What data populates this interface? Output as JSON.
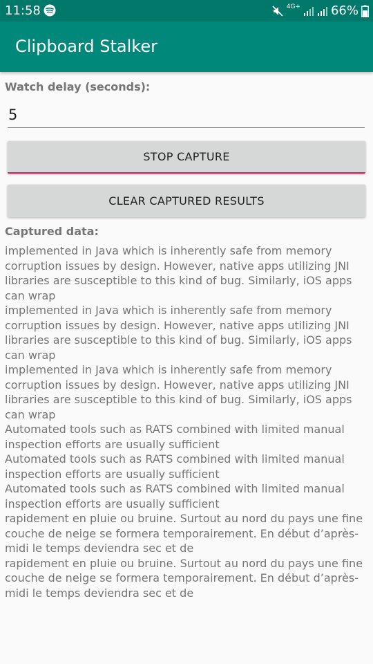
{
  "status_bar": {
    "time": "11:58",
    "network_label": "4G+",
    "battery": "66%"
  },
  "app": {
    "title": "Clipboard Stalker",
    "accent_color": "#00897b",
    "status_color": "#00796b"
  },
  "form": {
    "delay_label": "Watch delay (seconds):",
    "delay_value": "5",
    "stop_button": "STOP CAPTURE",
    "clear_button": "CLEAR CAPTURED RESULTS",
    "captured_label": "Captured data:"
  },
  "captured_text": "implemented in Java which is inherently safe from memory corruption issues by design. However, native apps utilizing JNI libraries are susceptible to this kind of bug. Similarly, iOS apps can wrap\nimplemented in Java which is inherently safe from memory corruption issues by design. However, native apps utilizing JNI libraries are susceptible to this kind of bug. Similarly, iOS apps can wrap\nimplemented in Java which is inherently safe from memory corruption issues by design. However, native apps utilizing JNI libraries are susceptible to this kind of bug. Similarly, iOS apps can wrap\nAutomated tools such as RATS combined with limited manual inspection efforts are usually sufficient\nAutomated tools such as RATS combined with limited manual inspection efforts are usually sufficient\nAutomated tools such as RATS combined with limited manual inspection efforts are usually sufficient\nrapidement en pluie ou bruine. Surtout au nord du pays une fine couche de neige se formera temporairement. En début d’après-midi le temps deviendra sec et de\nrapidement en pluie ou bruine. Surtout au nord du pays une fine couche de neige se formera temporairement. En début d’après-midi le temps deviendra sec et de"
}
